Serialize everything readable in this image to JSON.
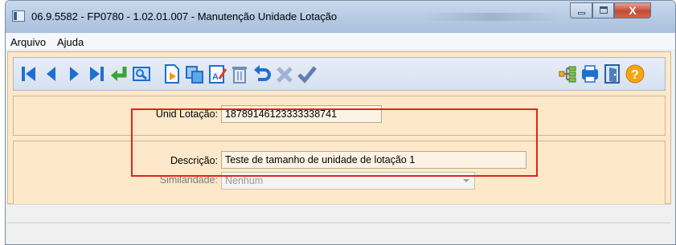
{
  "window": {
    "title": "06.9.5582 - FP0780 - 1.02.01.007 - Manutenção Unidade Lotação",
    "controls": {
      "minimize": "minimize",
      "maximize": "maximize",
      "close": "X"
    }
  },
  "menu": {
    "items": [
      {
        "label": "Arquivo"
      },
      {
        "label": "Ajuda"
      }
    ]
  },
  "toolbar": {
    "buttons": [
      {
        "icon": "first-record-icon"
      },
      {
        "icon": "previous-record-icon"
      },
      {
        "icon": "next-record-icon"
      },
      {
        "icon": "last-record-icon"
      },
      {
        "icon": "goto-icon"
      },
      {
        "icon": "search-icon"
      },
      {
        "icon": "new-record-icon"
      },
      {
        "icon": "copy-icon"
      },
      {
        "icon": "edit-icon"
      },
      {
        "icon": "delete-icon"
      },
      {
        "icon": "undo-icon"
      },
      {
        "icon": "cancel-icon"
      },
      {
        "icon": "save-icon"
      },
      {
        "icon": "related-icon"
      },
      {
        "icon": "print-icon"
      },
      {
        "icon": "exit-icon"
      },
      {
        "icon": "help-icon"
      }
    ]
  },
  "form": {
    "unid_lotacao": {
      "label": "Unid Lotação:",
      "value": "18789146123333338741"
    },
    "descricao": {
      "label": "Descrição:",
      "value": "Teste de tamanho de unidade de lotação 1"
    },
    "similaridade": {
      "label": "Similaridade:",
      "value": "Nenhum"
    }
  },
  "colors": {
    "panel_background": "#fde9c9",
    "highlight_border": "#e0241b",
    "toolbar_icon_blue": "#1f6fd1"
  }
}
